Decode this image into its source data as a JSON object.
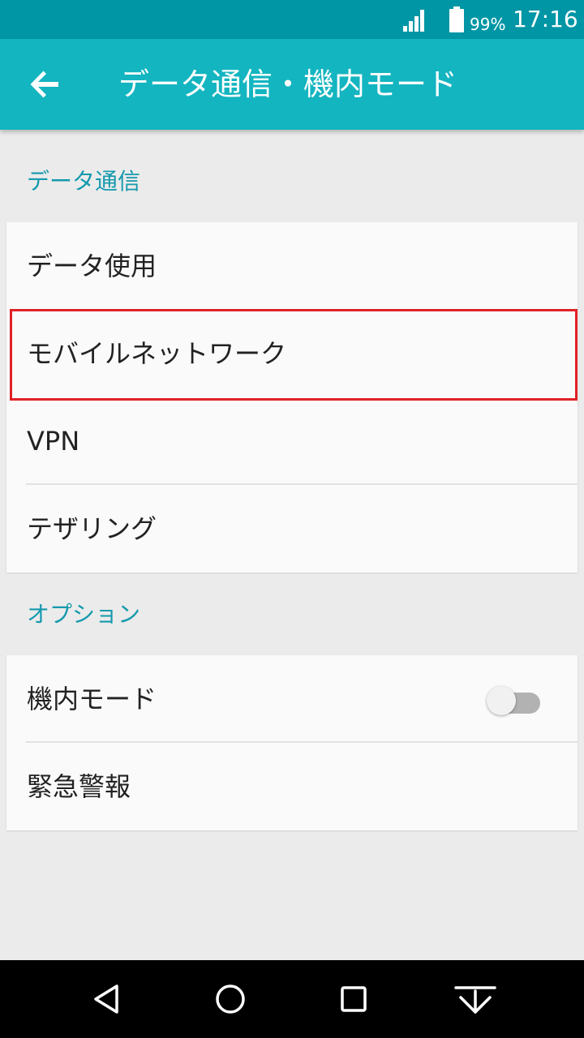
{
  "status_bar": {
    "battery_percent": "99%",
    "time": "17:16",
    "icons": [
      "signal-icon",
      "battery-icon"
    ]
  },
  "app_bar": {
    "title": "データ通信・機内モード",
    "back_icon": "back-arrow-icon"
  },
  "sections": {
    "data": {
      "header": "データ通信",
      "items": [
        "データ使用",
        "モバイルネットワーク",
        "VPN",
        "テザリング"
      ]
    },
    "options": {
      "header": "オプション",
      "airplane_mode": "機内モード",
      "airplane_mode_on": false,
      "emergency_alerts": "緊急警報"
    }
  },
  "colors": {
    "status_bar": "#0096a5",
    "app_bar": "#13b5c0",
    "accent_header": "#1499ad",
    "highlight_box": "#e02126"
  },
  "nav_bar": {
    "icons": [
      "nav-back-icon",
      "nav-home-icon",
      "nav-recents-icon",
      "nav-notification-icon"
    ]
  }
}
